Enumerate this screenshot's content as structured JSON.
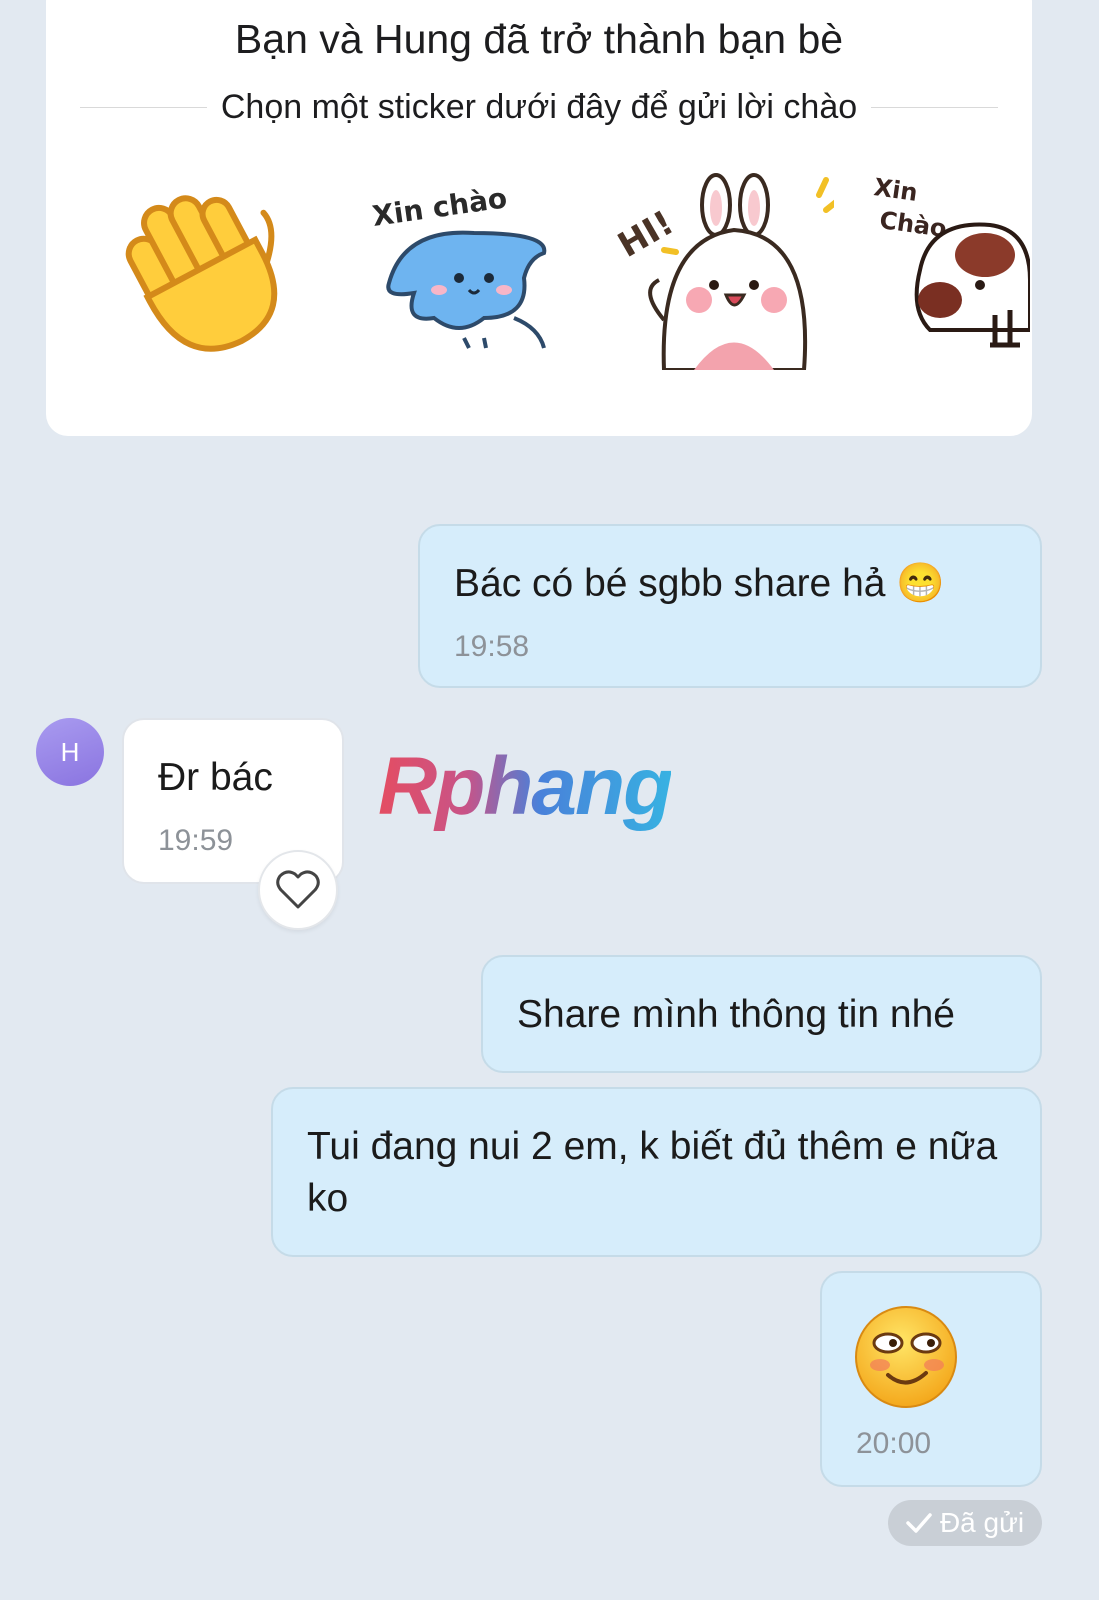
{
  "friend_card": {
    "title": "Bạn và Hung đã trở thành bạn bè",
    "subtitle": "Chọn một sticker dưới đây để gửi lời chào",
    "stickers": [
      {
        "name": "wave-hand-sticker",
        "caption": ""
      },
      {
        "name": "blue-cat-sticker",
        "caption": "Xin chào"
      },
      {
        "name": "bunny-hi-sticker",
        "caption": "HI!"
      },
      {
        "name": "dog-sticker",
        "caption": "Xin Chào"
      }
    ]
  },
  "contact": {
    "initial": "H"
  },
  "messages": [
    {
      "side": "out",
      "text": "Bác có bé sgbb share hả 😁",
      "time": "19:58"
    },
    {
      "side": "in",
      "text": "Đr bác",
      "time": "19:59"
    },
    {
      "side": "out",
      "text": "Share mình thông tin nhé",
      "time": ""
    },
    {
      "side": "out",
      "text": "Tui đang nui 2 em, k biết đủ thêm e nữa ko",
      "time": ""
    },
    {
      "side": "out",
      "sticker": "blushing-smile-emoji",
      "time": "20:00"
    }
  ],
  "watermark": "Rphang",
  "status": {
    "text": "Đã gửi",
    "icon": "check-icon"
  },
  "colors": {
    "background": "#e2e9f1",
    "outgoing_bubble": "#d6edfb",
    "incoming_bubble": "#ffffff"
  }
}
